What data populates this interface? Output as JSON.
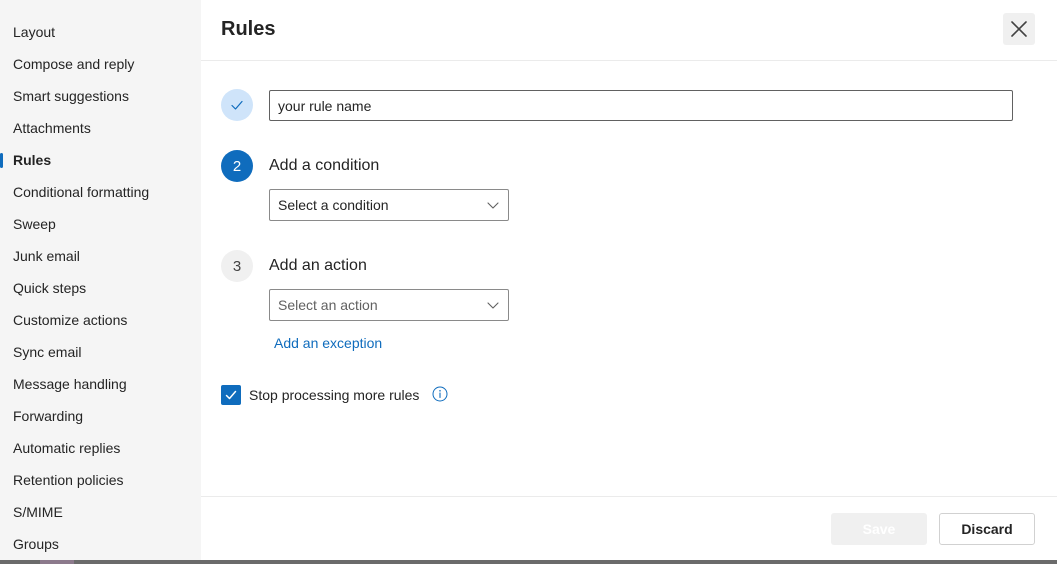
{
  "sidebar": {
    "items": [
      {
        "label": "Layout"
      },
      {
        "label": "Compose and reply"
      },
      {
        "label": "Smart suggestions"
      },
      {
        "label": "Attachments"
      },
      {
        "label": "Rules",
        "active": true
      },
      {
        "label": "Conditional formatting"
      },
      {
        "label": "Sweep"
      },
      {
        "label": "Junk email"
      },
      {
        "label": "Quick steps"
      },
      {
        "label": "Customize actions"
      },
      {
        "label": "Sync email"
      },
      {
        "label": "Message handling"
      },
      {
        "label": "Forwarding"
      },
      {
        "label": "Automatic replies"
      },
      {
        "label": "Retention policies"
      },
      {
        "label": "S/MIME"
      },
      {
        "label": "Groups"
      }
    ]
  },
  "header": {
    "title": "Rules",
    "close_icon": "close-icon"
  },
  "form": {
    "rule_name": {
      "value": "your rule name",
      "step_icon": "checkmark-icon"
    },
    "condition": {
      "step_number": "2",
      "label": "Add a condition",
      "dropdown_value": "Select a condition"
    },
    "action": {
      "step_number": "3",
      "label": "Add an action",
      "dropdown_value": "Select an action"
    },
    "exception_link": "Add an exception",
    "stop_processing": {
      "label": "Stop processing more rules",
      "checked": true
    }
  },
  "footer": {
    "save_label": "Save",
    "discard_label": "Discard"
  },
  "colors": {
    "accent": "#0f6cbd",
    "step_done_bg": "#cfe4fa",
    "sidebar_bg": "#f5f5f5"
  }
}
